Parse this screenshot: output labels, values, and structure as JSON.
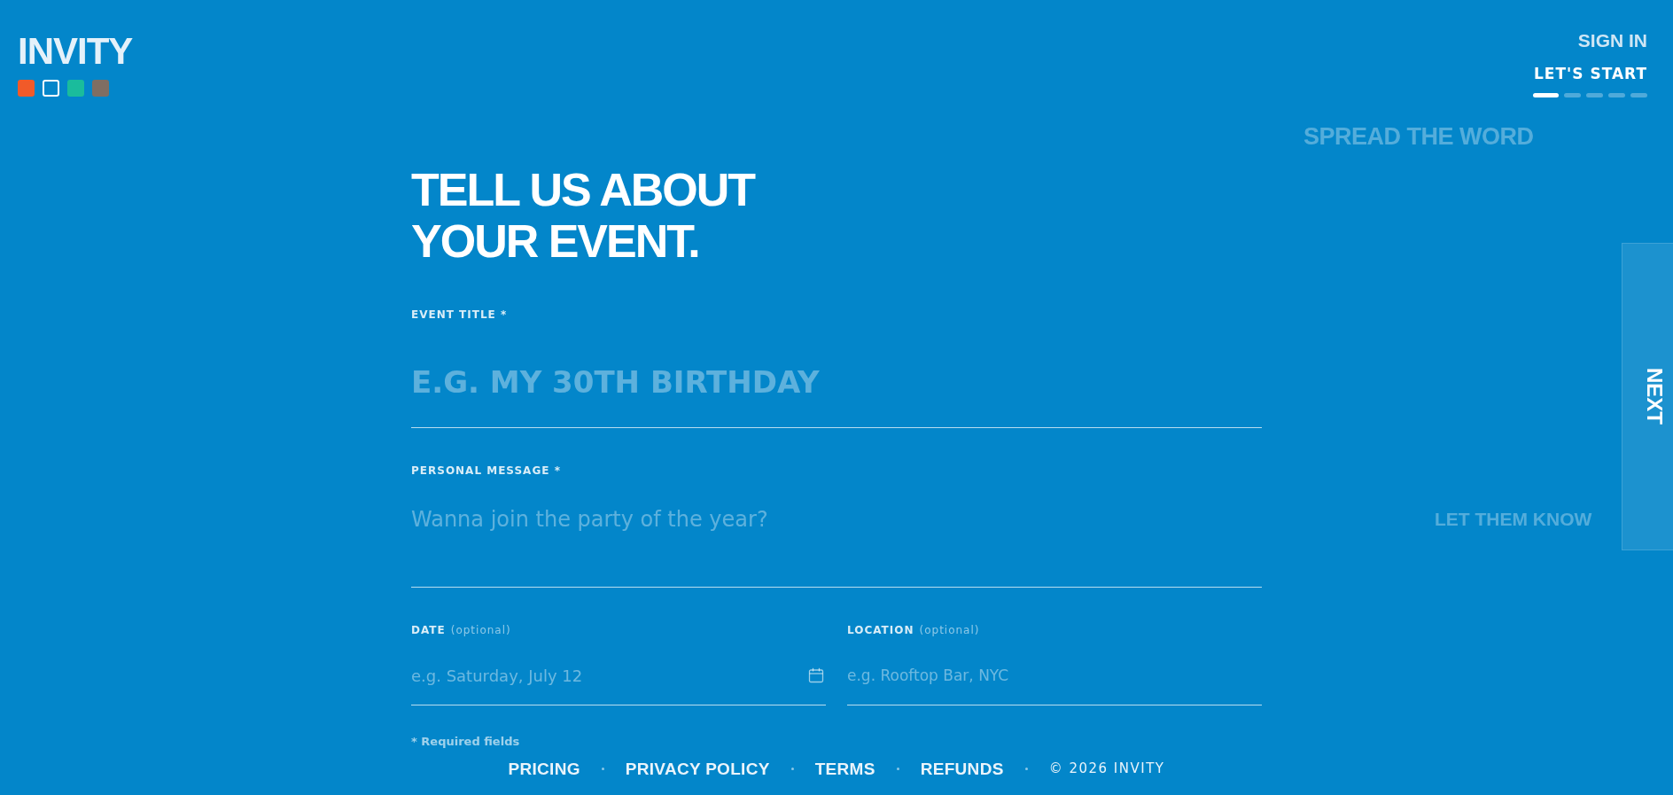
{
  "header": {
    "logo": "INVITY",
    "theme_swatches": [
      {
        "color": "#f15a29",
        "selected": false
      },
      {
        "color": "#0386ca",
        "selected": true
      },
      {
        "color": "#1abc9c",
        "selected": false
      },
      {
        "color": "#7f6e63",
        "selected": false
      }
    ]
  },
  "nav": {
    "sign_in": "SIGN IN",
    "current_step": "LET'S START",
    "steps": [
      {
        "selected": true
      },
      {
        "selected": false
      },
      {
        "selected": false
      },
      {
        "selected": false
      },
      {
        "selected": false
      }
    ]
  },
  "upcoming_steps": [
    {
      "title": "SPREAD THE WORD"
    },
    {
      "title": "LET THEM KNOW"
    }
  ],
  "form": {
    "heading": "TELL US ABOUT YOUR EVENT.",
    "fields": [
      {
        "kind": "headline",
        "label": "EVENT TITLE *",
        "placeholder": "E.G. MY 30TH BIRTHDAY"
      },
      {
        "kind": "multiline",
        "label": "PERSONAL MESSAGE *",
        "placeholder": "Wanna join the party of the year?"
      },
      {
        "kind": "date",
        "label": "DATE",
        "note": "(optional)",
        "placeholder": "e.g. Saturday, July 12"
      },
      {
        "kind": "text",
        "label": "LOCATION",
        "note": "(optional)",
        "placeholder": "e.g. Rooftop Bar, NYC"
      }
    ],
    "footnote": "* Required fields"
  },
  "next_button": "NEXT",
  "footer": {
    "links": [
      "PRICING",
      "PRIVACY POLICY",
      "TERMS",
      "REFUNDS"
    ],
    "copyright": "© 2026 INVITY"
  }
}
